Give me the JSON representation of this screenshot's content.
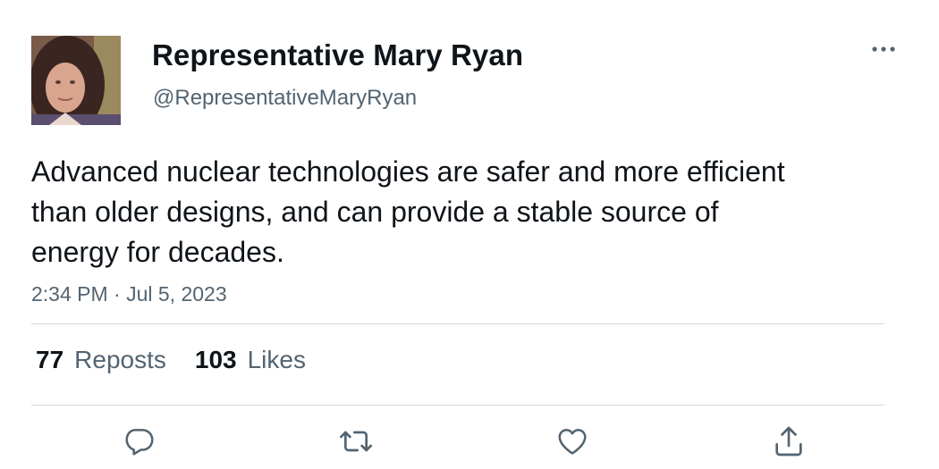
{
  "author": {
    "display_name": "Representative Mary Ryan",
    "handle": "@RepresentativeMaryRyan",
    "avatar_icon": "profile-photo"
  },
  "tweet": {
    "text": "Advanced nuclear technologies are safer and more efficient than older designs, and can provide a stable source of energy for decades.",
    "timestamp": "2:34 PM · Jul 5, 2023"
  },
  "stats": {
    "reposts_count": "77",
    "reposts_label": "Reposts",
    "likes_count": "103",
    "likes_label": "Likes"
  },
  "actions": [
    {
      "name": "reply",
      "icon": "reply-icon"
    },
    {
      "name": "repost",
      "icon": "repost-icon"
    },
    {
      "name": "like",
      "icon": "heart-icon"
    },
    {
      "name": "share",
      "icon": "share-icon"
    }
  ],
  "colors": {
    "text_primary": "#0f1419",
    "text_secondary": "#536471",
    "divider": "#cfd9de",
    "icon": "#536471"
  }
}
